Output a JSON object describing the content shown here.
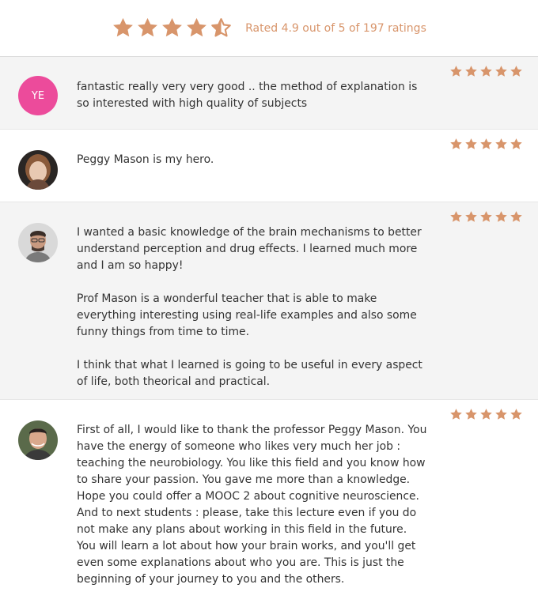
{
  "summary": {
    "rating_text": "Rated 4.9 out of 5 of 197 ratings",
    "stars": [
      "star-full-icon",
      "star-full-icon",
      "star-full-icon",
      "star-full-icon",
      "star-half-icon"
    ]
  },
  "colors": {
    "star": "#d8956b",
    "shaded_row": "#f4f4f4",
    "initials_avatar": "#ec4b9b"
  },
  "reviews": [
    {
      "avatar_initials": "YE",
      "stars": 5,
      "paragraphs": [
        "fantastic really very very good .. the method of explanation is so interested with high quality of subjects"
      ]
    },
    {
      "avatar": "photo",
      "stars": 5,
      "paragraphs": [
        "Peggy Mason is my hero."
      ]
    },
    {
      "avatar": "photo",
      "stars": 5,
      "paragraphs": [
        "I wanted a basic knowledge of the brain mechanisms to better understand perception and drug effects. I learned much more and I am so happy!",
        "Prof Mason is a wonderful teacher that is able to make everything interesting using real-life examples and also some funny things from time to time.",
        "I think that what I learned is going to be useful in every aspect of life, both theorical and practical."
      ]
    },
    {
      "avatar": "photo",
      "stars": 5,
      "paragraphs": [
        "First of all, I would like to thank the professor Peggy Mason. You have the energy of someone who likes very much her job : teaching the neurobiology. You like this field and you know how to share your passion. You gave me more than a knowledge. Hope you could offer a MOOC 2 about cognitive neuroscience. And to next students : please, take this lecture even if you do not make any plans about working in this field in the future. You will learn a lot about how your brain works, and you'll get even some explanations about who you are. This is just the beginning of your journey to you and the others."
      ]
    }
  ]
}
